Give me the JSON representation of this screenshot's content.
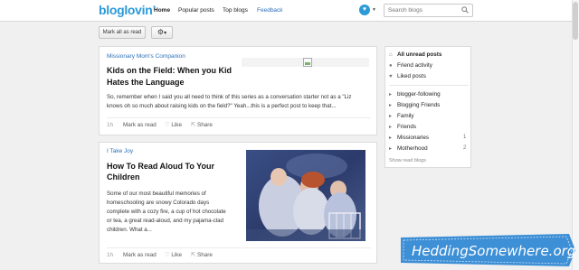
{
  "header": {
    "logo": "bloglovin’",
    "nav": [
      "Home",
      "Popular posts",
      "Top blogs",
      "Feedback"
    ],
    "search_placeholder": "Search blogs"
  },
  "toolbar": {
    "mark_all": "Mark all as read",
    "settings_caret": "▾"
  },
  "posts": [
    {
      "blog": "Missionary Mom's Companion",
      "title_lines": [
        "Kids on the Field: When you Kid",
        "Hates the Language"
      ],
      "excerpt_lines": [
        "So, remember when I said you all need to think of this series as a conversation starter not as a \"Liz",
        "knows oh so much about raising kids on the field?\"  Yeah...this is a perfect post to keep that..."
      ],
      "time": "1h",
      "mark": "Mark as read",
      "like": "Like",
      "share": "Share"
    },
    {
      "blog": "I Take Joy",
      "title_lines": [
        "How To Read Aloud To Your",
        "Children"
      ],
      "excerpt_lines": [
        "Some of our most beautiful memories of",
        "homeschooling are snowy Colorado days",
        "complete with a cozy fire, a cup of hot chocolate",
        "or tea, a great read-aloud, and my pajama-clad",
        "children.  What a..."
      ],
      "time": "1h",
      "mark": "Mark as read",
      "like": "Like",
      "share": "Share"
    }
  ],
  "sidebar": {
    "top": [
      {
        "label": "All unread posts",
        "icon": "home-icon"
      },
      {
        "label": "Friend activity",
        "icon": "person-icon"
      },
      {
        "label": "Liked posts",
        "icon": "heart-icon"
      }
    ],
    "groups": [
      {
        "label": "blogger-following",
        "count": ""
      },
      {
        "label": "Blogging Friends",
        "count": ""
      },
      {
        "label": "Family",
        "count": ""
      },
      {
        "label": "Friends",
        "count": ""
      },
      {
        "label": "Missionaries",
        "count": "1"
      },
      {
        "label": "Motherhood",
        "count": "2"
      }
    ],
    "show_read": "Show read blogs"
  },
  "watermark_text": "HeddingSomewhere.org",
  "colors": {
    "brand": "#2b9ad8",
    "link": "#2b6fb8",
    "watermark": "#3d8fd6"
  }
}
